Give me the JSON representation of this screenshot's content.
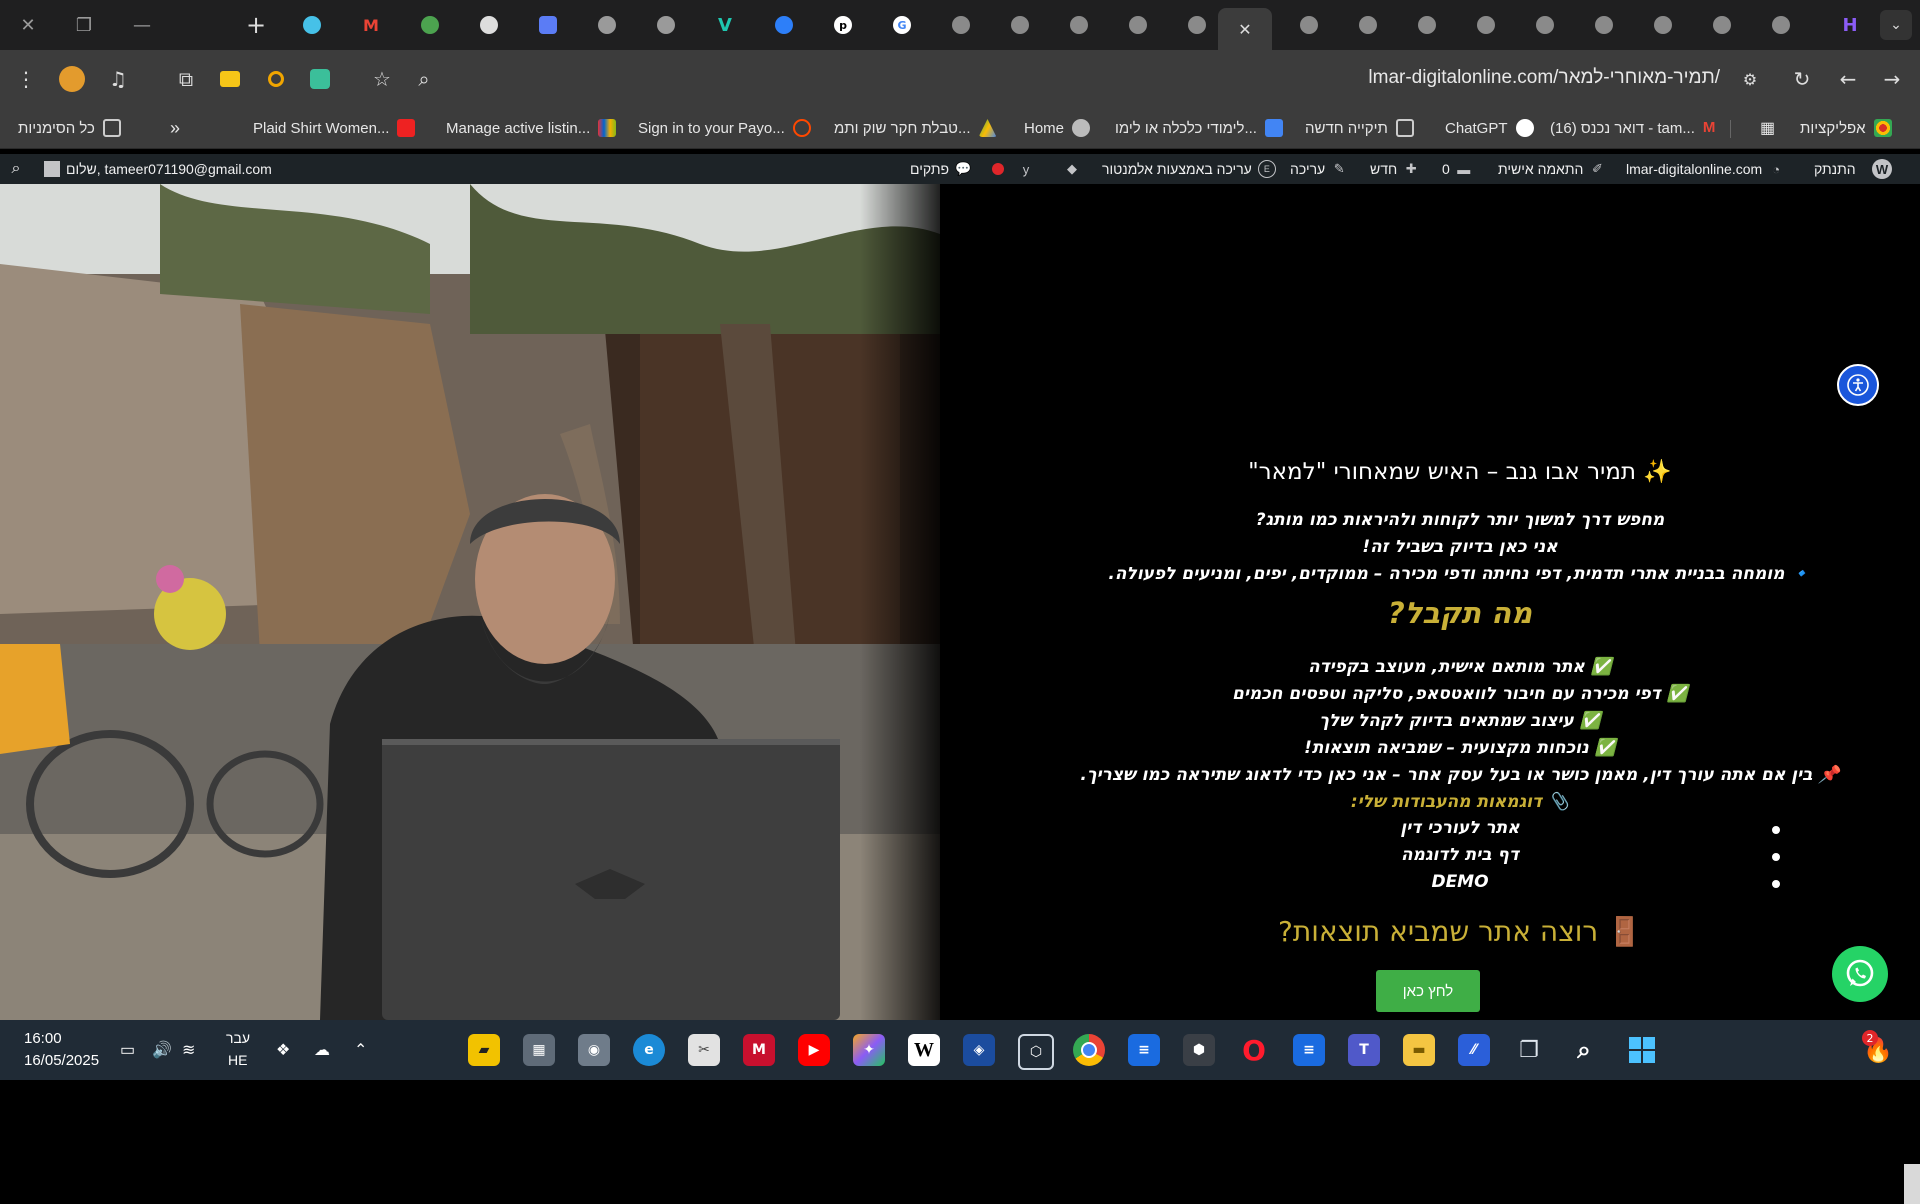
{
  "browser": {
    "url": "lmar-digitalonline.com/תמיר-מאוחרי-למאר/",
    "active_tab_close": "✕",
    "new_tab": "+",
    "window_minimize": "—",
    "window_restore": "❐",
    "window_close": "✕"
  },
  "tabs": [
    {
      "icon": "generic-icon",
      "letter": "",
      "color": "#8a8a8a"
    }
  ],
  "bookmarks": {
    "items": [
      {
        "label": "אפליקציות",
        "icon_color": "#d93025"
      },
      {
        "label": "דואר נכנס (16) - tam...",
        "icon_color": "#ea4335"
      },
      {
        "label": "ChatGPT",
        "icon_color": "#ffffff"
      },
      {
        "label": "תיקייה חדשה",
        "icon_color": "#cccccc"
      },
      {
        "label": "לימודי כלכלה או לימו...",
        "icon_color": "#4285f4"
      },
      {
        "label": "Home",
        "icon_color": "#bbbbbb"
      },
      {
        "label": "טבלת חקר שוק ותמ...",
        "icon_color": "#34a853"
      },
      {
        "label": "Sign in to your Payo...",
        "icon_color": "#ff4800"
      },
      {
        "label": "Manage active listin...",
        "icon_color": "#e53238"
      },
      {
        "label": "Plaid Shirt Women...",
        "icon_color": "#ee2222"
      }
    ],
    "all_bookmarks": "כל הסימניות",
    "more": "»"
  },
  "wpbar": {
    "howdy": "שלום, tameer071190@gmail.com",
    "site": "lmar-digitalonline.com",
    "customize": "התאמה אישית",
    "comments_count": "0",
    "new": "חדש",
    "edit": "עריכה",
    "elementor": "עריכה באמצעות אלמנטור",
    "notes": "פתקים",
    "logout": "התנתק"
  },
  "content": {
    "title": "✨ תמיר אבו גנב – האיש שמאחורי \"למאר\"",
    "intro1": "מחפש דרך למשוך יותר לקוחות ולהיראות כמו מותג?",
    "intro2": "אני כאן בדיוק בשביל זה!",
    "intro3": "🔹 מומחה בבניית אתרי תדמית, דפי נחיתה ודפי מכירה – ממוקדים, יפים, ומניעים לפעולה.",
    "subheading": "מה תקבל?",
    "benefit1": "✅ אתר מותאם אישית, מעוצב בקפידה",
    "benefit2": "✅ דפי מכירה עם חיבור לוואטסאפ, סליקה וטפסים חכמים",
    "benefit3": "✅ עיצוב שמתאים בדיוק לקהל שלך",
    "benefit4": "✅ נוכחות מקצועית – שמביאה תוצאות!",
    "pin": "📌 בין אם אתה עורך דין, מאמן כושר או בעל עסק אחר – אני כאן כדי לדאוג שתיראה כמו שצריך.",
    "examples": "📎 דוגמאות מהעבודות שלי:",
    "list": [
      "אתר לעורכי דין",
      "דף בית לדוגמה",
      "DEMO"
    ],
    "cta_heading": "🚪 רוצה אתר שמביא תוצאות?",
    "cta_button": "לחץ כאן"
  },
  "taskbar": {
    "time": "16:00",
    "date": "16/05/2025",
    "lang_top": "עבר",
    "lang_bottom": "HE",
    "notif_count": "2"
  }
}
